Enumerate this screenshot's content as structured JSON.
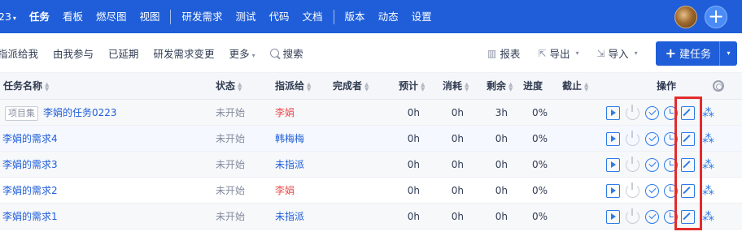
{
  "nav": {
    "project_fragment": "23",
    "items": [
      "任务",
      "看板",
      "燃尽图",
      "视图",
      "研发需求",
      "测试",
      "代码",
      "文档",
      "版本",
      "动态",
      "设置"
    ],
    "active": "任务"
  },
  "filters": [
    "指派给我",
    "由我参与",
    "已延期",
    "研发需求变更",
    "更多",
    "搜索"
  ],
  "tools": {
    "report": "报表",
    "export": "导出",
    "import": "导入",
    "create": "建任务"
  },
  "columns": {
    "name": "任务名称",
    "status": "状态",
    "assignee": "指派给",
    "finisher": "完成者",
    "estimate": "预计",
    "consumed": "消耗",
    "left": "剩余",
    "progress": "进度",
    "deadline": "截止",
    "actions": "操作"
  },
  "rows": [
    {
      "tag": "项目集",
      "name": "李娟的任务0223",
      "status": "未开始",
      "assignee": "李娟",
      "assignee_color": "#eb4c4c",
      "estimate": "0h",
      "consumed": "0h",
      "left": "3h",
      "progress": "0%"
    },
    {
      "tag": "",
      "name": "李娟的需求4",
      "status": "未开始",
      "assignee": "韩梅梅",
      "assignee_color": "#1f5ed8",
      "estimate": "0h",
      "consumed": "0h",
      "left": "0h",
      "progress": "0%"
    },
    {
      "tag": "",
      "name": "李娟的需求3",
      "status": "未开始",
      "assignee": "未指派",
      "assignee_color": "#1f5ed8",
      "estimate": "0h",
      "consumed": "0h",
      "left": "0h",
      "progress": "0%"
    },
    {
      "tag": "",
      "name": "李娟的需求2",
      "status": "未开始",
      "assignee": "李娟",
      "assignee_color": "#eb4c4c",
      "estimate": "0h",
      "consumed": "0h",
      "left": "0h",
      "progress": "0%"
    },
    {
      "tag": "",
      "name": "李娟的需求1",
      "status": "未开始",
      "assignee": "未指派",
      "assignee_color": "#1f5ed8",
      "estimate": "0h",
      "consumed": "0h",
      "left": "0h",
      "progress": "0%"
    }
  ],
  "row_actions": [
    "play-icon",
    "power-icon",
    "check-circle-icon",
    "clock-icon",
    "edit-icon",
    "tree-icon"
  ],
  "colors": {
    "primary": "#1f5ed8",
    "highlight": "#e32b2b",
    "danger": "#eb4c4c"
  }
}
